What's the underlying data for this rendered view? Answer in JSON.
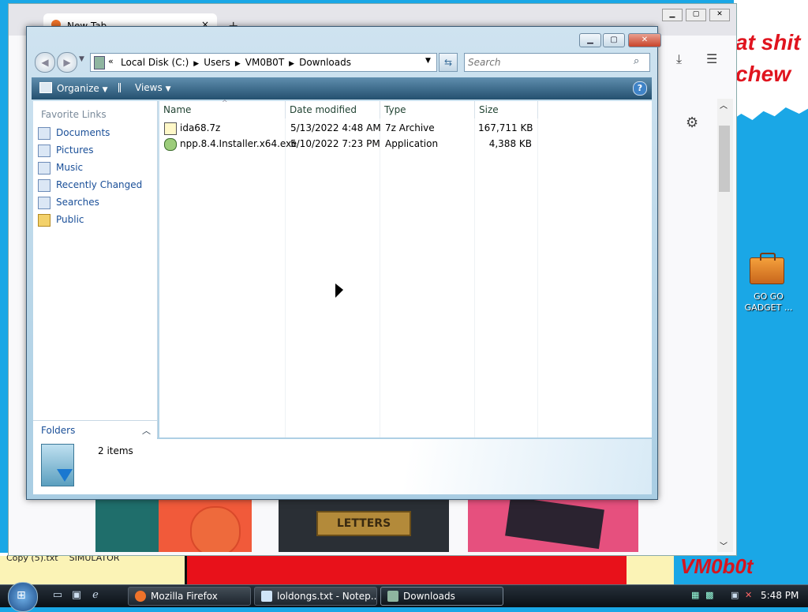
{
  "wallpaper": {
    "top_text": "at shit\nchew",
    "signature": "VM0b0t",
    "bottom_labels": "Copy (5).txt    SIMULATOR"
  },
  "firefox": {
    "tab_label": "New Tab",
    "tab_close": "×",
    "new_tab": "+",
    "tile2_text": "LETTERS"
  },
  "desktop_icon": {
    "label": "GO GO\nGADGET ..."
  },
  "explorer": {
    "address": {
      "chev": "«",
      "crumbs": [
        "Local Disk (C:)",
        "Users",
        "VM0B0T",
        "Downloads"
      ]
    },
    "search": {
      "placeholder": "Search"
    },
    "commands": {
      "organize": "Organize",
      "views": "Views"
    },
    "favorites": {
      "header": "Favorite Links",
      "items": [
        "Documents",
        "Pictures",
        "Music",
        "Recently Changed",
        "Searches",
        "Public"
      ]
    },
    "folders_label": "Folders",
    "columns": {
      "name": "Name",
      "date": "Date modified",
      "type": "Type",
      "size": "Size"
    },
    "files": [
      {
        "name": "ida68.7z",
        "date": "5/13/2022 4:48 AM",
        "type": "7z Archive",
        "size": "167,711 KB"
      },
      {
        "name": "npp.8.4.Installer.x64.exe",
        "date": "5/10/2022 7:23 PM",
        "type": "Application",
        "size": "4,388 KB"
      }
    ],
    "details": {
      "count": "2 items"
    }
  },
  "taskbar": {
    "tasks": [
      "Mozilla Firefox",
      "loldongs.txt - Notep...",
      "Downloads"
    ],
    "clock": "5:48 PM"
  }
}
